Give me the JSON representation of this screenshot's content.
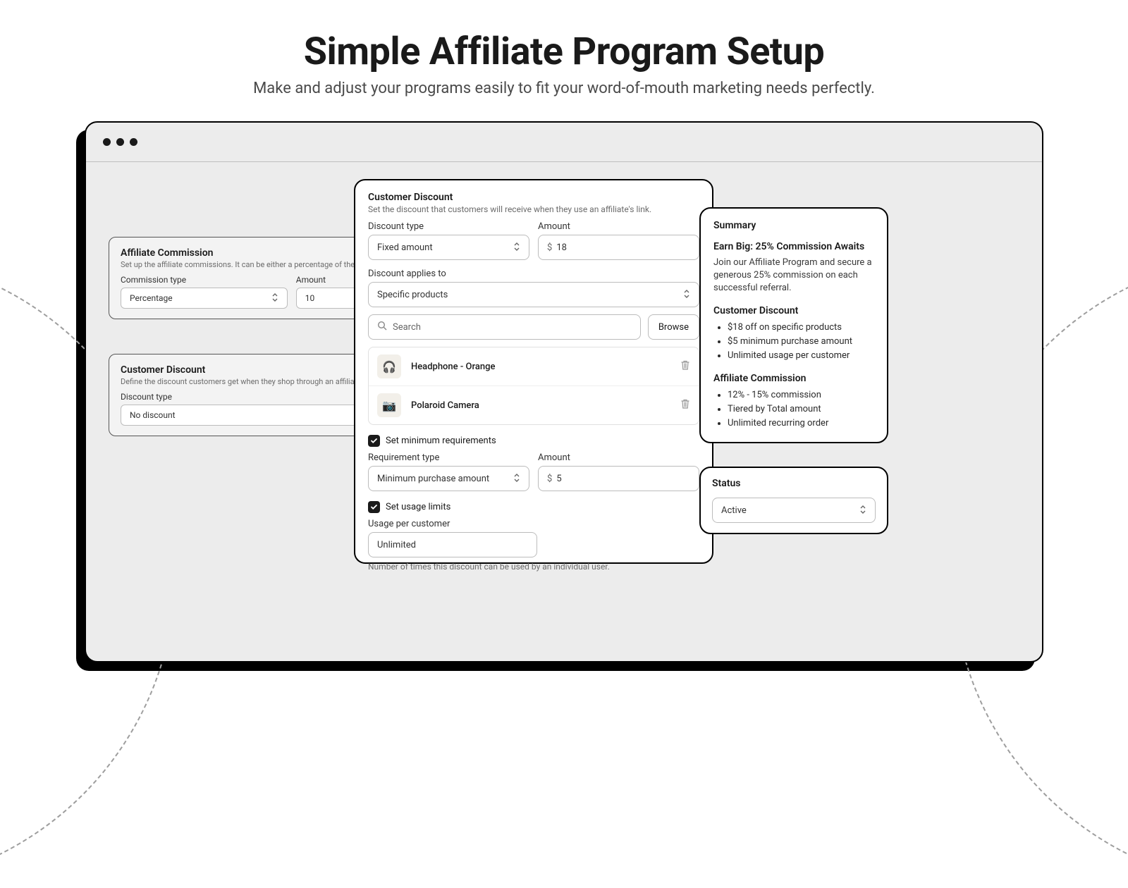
{
  "hero": {
    "title": "Simple Affiliate Program Setup",
    "subtitle": "Make and adjust your programs easily to fit your word-of-mouth marketing needs perfectly."
  },
  "affiliate_card": {
    "title": "Affiliate Commission",
    "subtitle": "Set up the affiliate commissions. It can be either a percentage of the sale or",
    "commission_type_label": "Commission type",
    "commission_type_value": "Percentage",
    "amount_label": "Amount",
    "amount_value": "10"
  },
  "customer_card_bg": {
    "title": "Customer Discount",
    "subtitle": "Define the discount customers get when they shop through an affiliate's link.",
    "discount_type_label": "Discount type",
    "discount_type_value": "No discount"
  },
  "main": {
    "title": "Customer Discount",
    "subtitle": "Set the discount that customers will receive when they use an affiliate's link.",
    "discount_type_label": "Discount type",
    "discount_type_value": "Fixed amount",
    "amount_label": "Amount",
    "amount_currency": "$",
    "amount_value": "18",
    "applies_label": "Discount applies to",
    "applies_value": "Specific products",
    "search_placeholder": "Search",
    "browse_label": "Browse",
    "products": [
      {
        "name": "Headphone - Orange",
        "emoji": "🎧"
      },
      {
        "name": "Polaroid Camera",
        "emoji": "📷"
      }
    ],
    "min_req_checkbox": "Set minimum requirements",
    "req_type_label": "Requirement type",
    "req_type_value": "Minimum purchase amount",
    "req_amount_label": "Amount",
    "req_amount_currency": "$",
    "req_amount_value": "5",
    "usage_checkbox": "Set usage limits",
    "usage_label": "Usage per customer",
    "usage_value": "Unlimited",
    "usage_note": "Number of times this discount can be used by an individual user."
  },
  "summary": {
    "title": "Summary",
    "headline": "Earn Big: 25% Commission Awaits",
    "paragraph": "Join our Affiliate Program and secure a generous 25% commission on each successful referral.",
    "discount_title": "Customer Discount",
    "discount_items": [
      "$18 off on specific products",
      "$5 minimum purchase amount",
      "Unlimited usage per customer"
    ],
    "commission_title": "Affiliate Commission",
    "commission_items": [
      "12% - 15% commission",
      "Tiered by Total amount",
      "Unlimited recurring order"
    ]
  },
  "status": {
    "title": "Status",
    "value": "Active"
  }
}
